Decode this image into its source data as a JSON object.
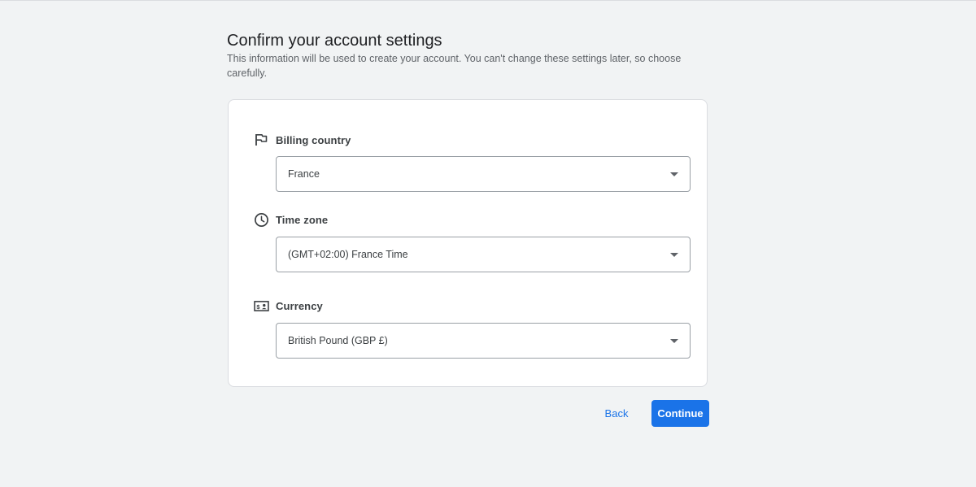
{
  "header": {
    "title": "Confirm your account settings",
    "subtitle": "This information will be used to create your account. You can't change these settings later, so choose carefully."
  },
  "fields": {
    "billing_country": {
      "label": "Billing country",
      "icon": "flag-icon",
      "value": "France"
    },
    "time_zone": {
      "label": "Time zone",
      "icon": "clock-icon",
      "value": "(GMT+02:00) France Time"
    },
    "currency": {
      "label": "Currency",
      "icon": "currency-icon",
      "value": "British Pound (GBP £)"
    }
  },
  "actions": {
    "back_label": "Back",
    "continue_label": "Continue"
  },
  "colors": {
    "accent": "#1a73e8",
    "background": "#f1f3f4",
    "card": "#ffffff"
  }
}
